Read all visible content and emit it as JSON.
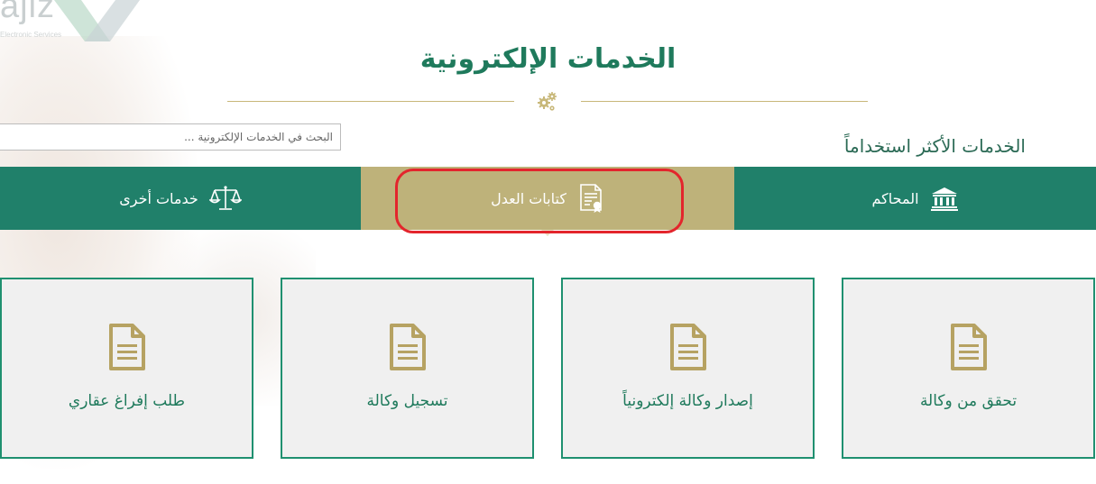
{
  "logo": {
    "text": "ajiz",
    "subtext": "Electronic Services"
  },
  "page_title": "الخدمات الإلكترونية",
  "search": {
    "placeholder": "البحث في الخدمات الإلكترونية ..."
  },
  "section_title": "الخدمات الأكثر استخداماً",
  "tabs": [
    {
      "label": "المحاكم",
      "icon": "court-building-icon"
    },
    {
      "label": "كتابات العدل",
      "icon": "certificate-icon",
      "active": true
    },
    {
      "label": "خدمات أخرى",
      "icon": "scales-icon"
    }
  ],
  "cards": [
    {
      "label": "تحقق من وكالة",
      "icon": "document-icon"
    },
    {
      "label": "إصدار وكالة إلكترونياً",
      "icon": "document-icon"
    },
    {
      "label": "تسجيل وكالة",
      "icon": "document-icon"
    },
    {
      "label": "طلب إفراغ عقاري",
      "icon": "document-icon"
    }
  ],
  "colors": {
    "brand_green": "#20806a",
    "title_green": "#1f7a5c",
    "gold": "#beb27a",
    "icon_gold": "#b6a262",
    "highlight_red": "#e3252c"
  }
}
